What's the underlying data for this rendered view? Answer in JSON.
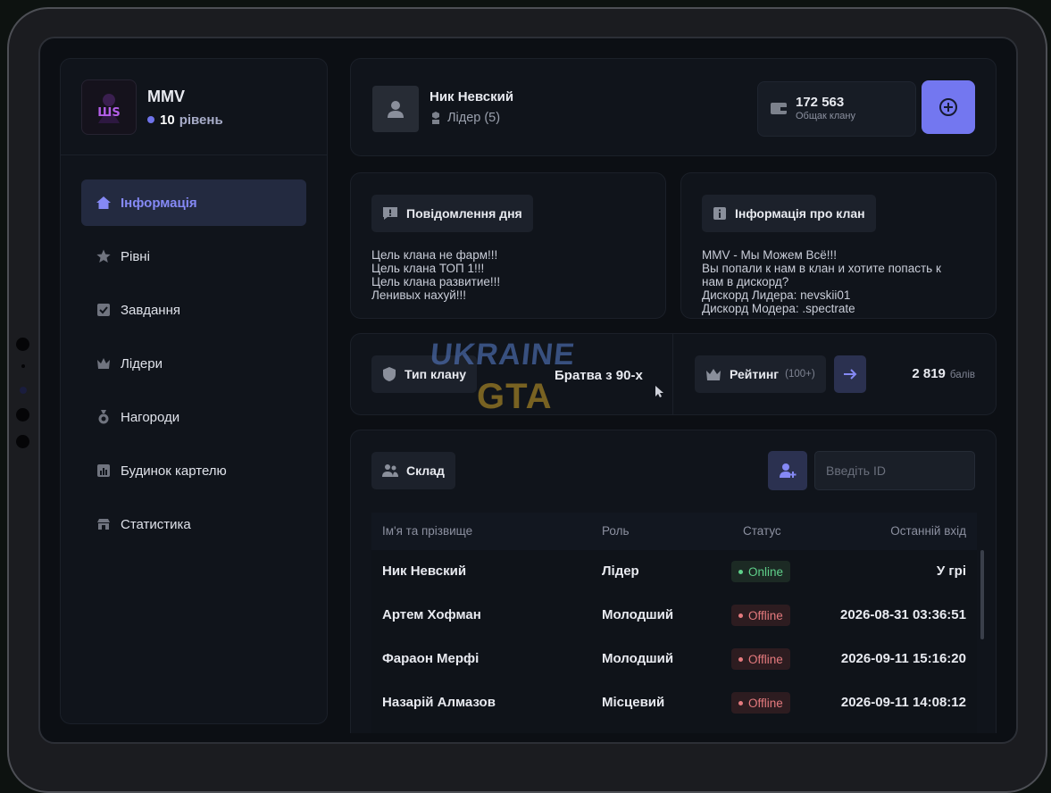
{
  "clan": {
    "name": "MMV",
    "level_num": "10",
    "level_word": "рівень"
  },
  "nav": [
    {
      "label": "Інформація",
      "icon": "home-icon"
    },
    {
      "label": "Рівні",
      "icon": "star-icon"
    },
    {
      "label": "Завдання",
      "icon": "checkbox-icon"
    },
    {
      "label": "Лідери",
      "icon": "crown-icon"
    },
    {
      "label": "Нагороди",
      "icon": "medal-icon"
    },
    {
      "label": "Будинок картелю",
      "icon": "bar-chart-icon"
    },
    {
      "label": "Статистика",
      "icon": "store-icon"
    }
  ],
  "user": {
    "name": "Ник Невский",
    "role": "Лідер (5)"
  },
  "money": {
    "amount": "172 563",
    "label": "Общак клану"
  },
  "motd": {
    "title": "Повідомлення дня",
    "lines": [
      "Цель клана не фарм!!!",
      "Цель клана ТОП 1!!!",
      "Цель клана развитие!!!",
      "Ленивых нахуй!!!"
    ]
  },
  "info": {
    "title": "Інформація про клан",
    "lines": [
      "MMV - Мы Можем Всё!!!",
      "Вы попали к нам в клан и хотите попасть к",
      "нам в дискорд?",
      "Дискорд Лидера: nevskii01",
      "Дискорд Модера: .spectrate"
    ]
  },
  "clan_type": {
    "label": "Тип клану",
    "value": "Братва з 90-х"
  },
  "rating": {
    "label": "Рейтинг",
    "hint": "(100+)",
    "score": "2 819",
    "unit": "балів"
  },
  "storage": {
    "label": "Склад",
    "id_placeholder": "Введіть ID"
  },
  "table": {
    "headers": [
      "Ім'я та прізвище",
      "Роль",
      "Статус",
      "Останній вхід"
    ],
    "rows": [
      {
        "name": "Ник Невский",
        "role": "Лідер",
        "status": "Online",
        "last": "У грі"
      },
      {
        "name": "Артем Хофман",
        "role": "Молодший",
        "status": "Offline",
        "last": "2026-08-31 03:36:51"
      },
      {
        "name": "Фараон Мерфі",
        "role": "Молодший",
        "status": "Offline",
        "last": "2026-09-11 15:16:20"
      },
      {
        "name": "Назарій Алмазов",
        "role": "Місцевий",
        "status": "Offline",
        "last": "2026-09-11 14:08:12"
      }
    ]
  },
  "watermark": {
    "line1": "UKRAINE",
    "line2": "GTA"
  },
  "colors": {
    "accent": "#7377f0",
    "online": "#5fd08a",
    "offline": "#e57a7e"
  }
}
